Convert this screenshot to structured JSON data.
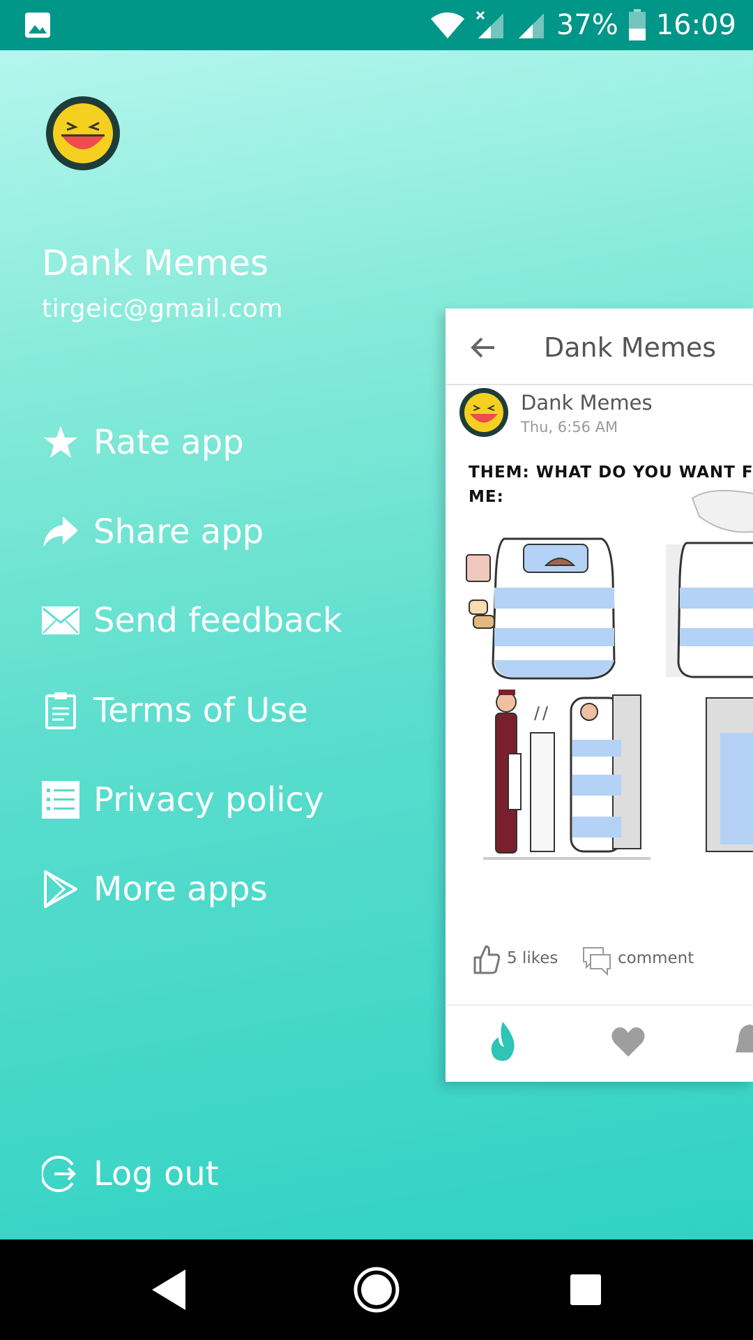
{
  "status_bar": {
    "battery_percent": "37%",
    "time": "16:09",
    "icons": [
      "gallery-icon",
      "wifi-icon",
      "signal-no-service-icon",
      "signal-icon",
      "battery-icon"
    ]
  },
  "drawer": {
    "app_name": "Dank Memes",
    "email": "tirgeic@gmail.com",
    "menu": [
      {
        "label": "Rate app",
        "icon": "star-icon"
      },
      {
        "label": "Share app",
        "icon": "share-icon"
      },
      {
        "label": "Send feedback",
        "icon": "mail-icon"
      },
      {
        "label": "Terms of Use",
        "icon": "clipboard-icon"
      },
      {
        "label": "Privacy policy",
        "icon": "list-icon"
      },
      {
        "label": "More apps",
        "icon": "play-store-icon"
      }
    ],
    "logout_label": "Log out"
  },
  "preview": {
    "title": "Dank Memes",
    "post": {
      "author": "Dank Memes",
      "time": "Thu, 6:56 AM",
      "text_line1": "THEM: WHAT DO YOU WANT F",
      "text_line2": "ME:",
      "likes": "5 likes",
      "comment_label": "comment"
    },
    "tabs": [
      "flame-icon",
      "heart-icon",
      "bell-icon"
    ]
  },
  "colors": {
    "status_bar": "#009688",
    "accent": "#2ec4b6",
    "drawer_top": "#b4f6ee",
    "drawer_bottom": "#30d2c4"
  }
}
